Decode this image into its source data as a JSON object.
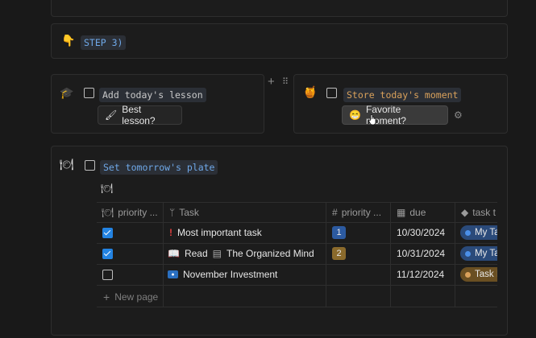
{
  "step": {
    "icon": "pointing-down-emoji",
    "label": "STEP 3)"
  },
  "lesson": {
    "icon": "graduation-cap-emoji",
    "label": "Add today's lesson",
    "button_label": "Best lesson?",
    "button_icon": "brush-emoji"
  },
  "moment": {
    "icon": "honey-pot-emoji",
    "label": "Store today's moment",
    "button_label": "Favorite moment?",
    "button_icon": "grinning-face-emoji"
  },
  "plate": {
    "icon": "plate-with-cutlery-emoji",
    "label": "Set tomorrow's plate",
    "view_icon": "plate-with-cutlery-emoji"
  },
  "table": {
    "columns": [
      "priority ...",
      "Task",
      "priority ...",
      "due",
      "task t"
    ],
    "rows": [
      {
        "checked": true,
        "task_icon": "exclamation-icon",
        "task_prefix": "",
        "task_title": "Most important task",
        "priority": "1",
        "due": "10/30/2024",
        "type": "My Ta",
        "type_color": "#2f6bbd"
      },
      {
        "checked": true,
        "task_icon": "open-book-icon",
        "task_prefix": "Read",
        "task_title": "The Organized Mind",
        "priority": "2",
        "due": "10/31/2024",
        "type": "My Ta",
        "type_color": "#2f6bbd"
      },
      {
        "checked": false,
        "task_icon": "eye-icon",
        "task_prefix": "",
        "task_title": "November Investment",
        "priority": "",
        "due": "11/12/2024",
        "type": "Task I",
        "type_color": "#8a6a2c"
      }
    ],
    "new_page_label": "New page"
  },
  "colors": {
    "background": "#191919",
    "accent": "#2383e2",
    "priority_1": "#2c5aa0",
    "priority_2": "#8a6a2c",
    "code_blue": "#6fa8e8",
    "code_orange": "#d9a15b"
  }
}
